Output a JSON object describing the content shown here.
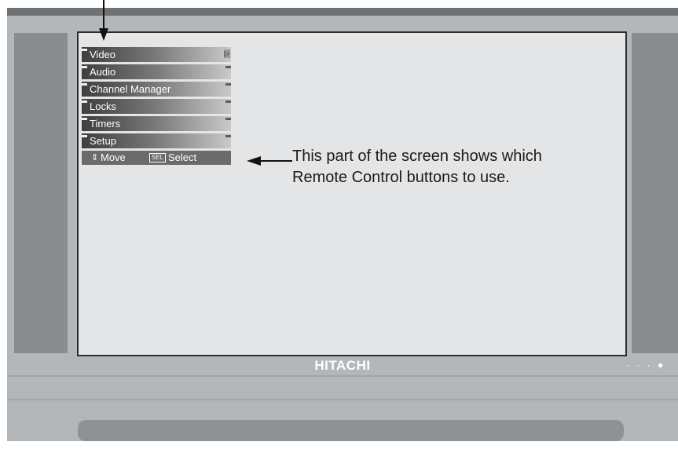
{
  "tv": {
    "brand": "HITACHI",
    "indicator": "· · · ●"
  },
  "menu": {
    "items": [
      {
        "label": "Video",
        "has_arrow": true
      },
      {
        "label": "Audio",
        "has_arrow": false
      },
      {
        "label": "Channel Manager",
        "has_arrow": false
      },
      {
        "label": "Locks",
        "has_arrow": false
      },
      {
        "label": "Timers",
        "has_arrow": false
      },
      {
        "label": "Setup",
        "has_arrow": false
      }
    ],
    "help": {
      "move_icon": "⇕",
      "move_label": "Move",
      "sel_icon": "SEL",
      "select_label": "Select"
    }
  },
  "callout": {
    "line1": "This part of the screen shows which",
    "line2": "Remote Control buttons to use."
  },
  "colors": {
    "screen_bg": "#e4e5e7",
    "bezel": "#b4b7ba",
    "speaker": "#8a8d8f",
    "help_bar": "#6b6b6b"
  }
}
